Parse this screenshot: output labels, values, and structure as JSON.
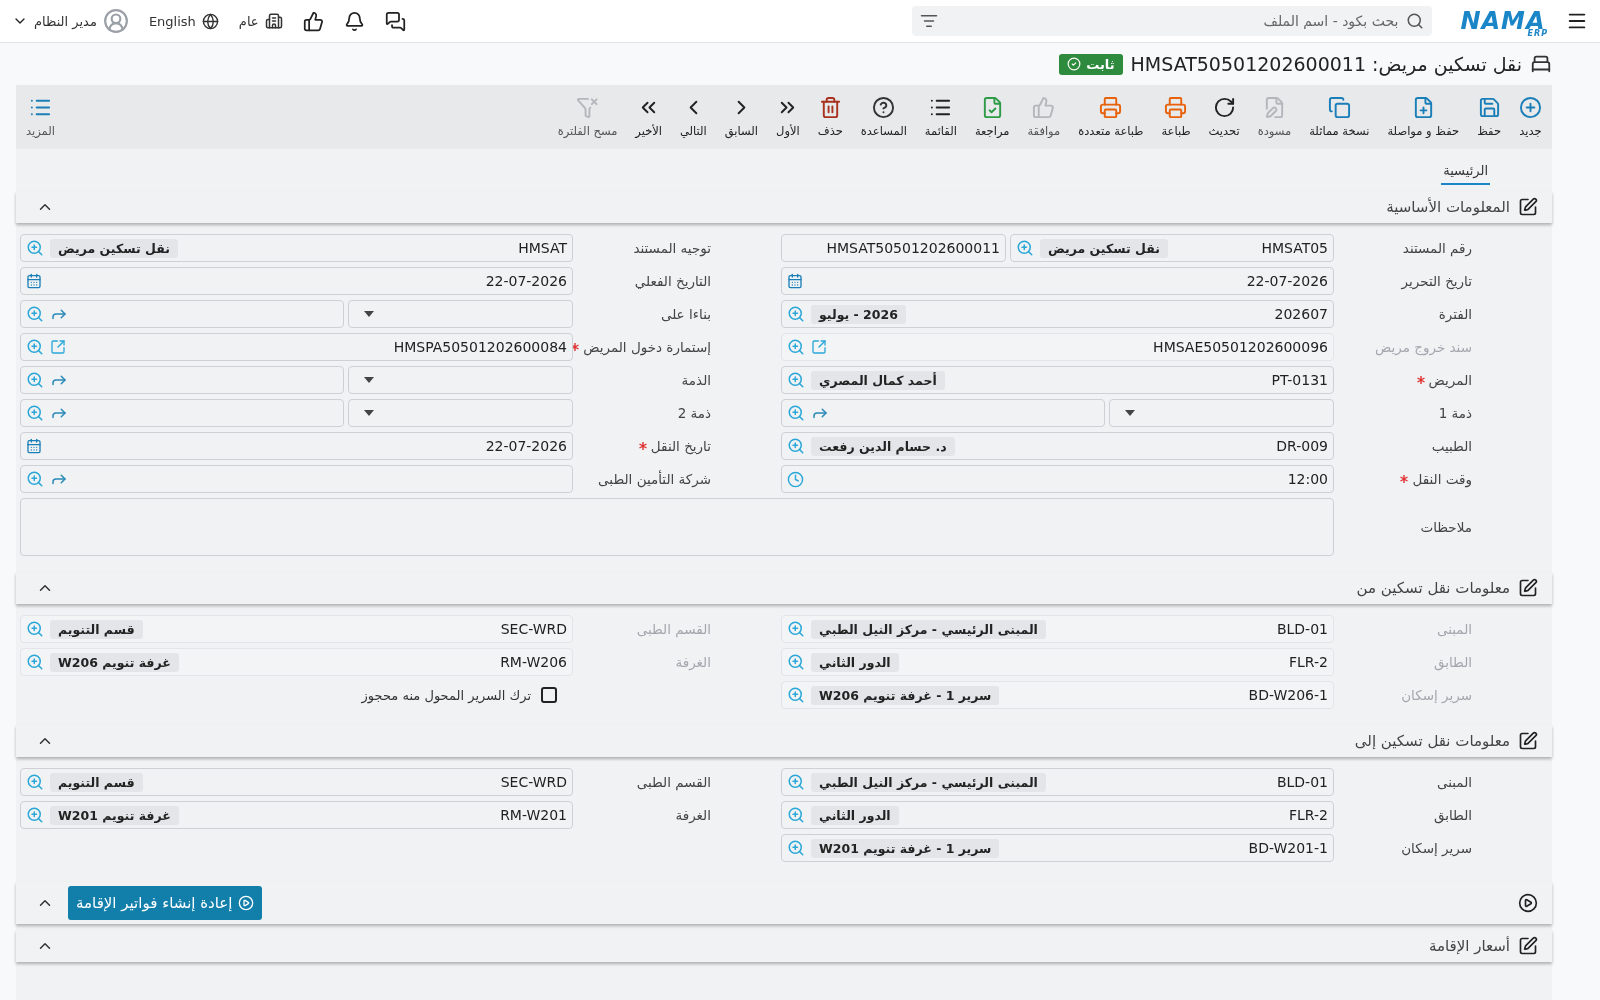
{
  "topbar": {
    "logo": {
      "name": "NAMA",
      "sub": "ERP"
    },
    "search": {
      "placeholder": "بحث بكود - اسم الملف"
    },
    "company": "عام",
    "language": "English",
    "user": "مدير النظام"
  },
  "title": {
    "text": "نقل تسكين مريض: HMSAT50501202600011",
    "status": "ثابت"
  },
  "toolbar": {
    "items": [
      {
        "kind": "new",
        "label": "جديد",
        "color": "#1a7fb8",
        "disabled": false
      },
      {
        "kind": "save",
        "label": "حفظ",
        "color": "#1a7fb8",
        "disabled": false
      },
      {
        "kind": "save-continue",
        "label": "حفظ و مواصلة",
        "color": "#1a7fb8",
        "disabled": false
      },
      {
        "kind": "duplicate",
        "label": "نسخة مماثلة",
        "color": "#1a7fb8",
        "disabled": false
      },
      {
        "kind": "draft",
        "label": "مسودة",
        "color": "#b3b7bc",
        "disabled": true
      },
      {
        "kind": "refresh",
        "label": "تحديث",
        "color": "#222222",
        "disabled": false
      },
      {
        "kind": "print",
        "label": "طباعة",
        "color": "#e8620c",
        "disabled": false
      },
      {
        "kind": "print-multi",
        "label": "طباعة متعددة",
        "color": "#e8620c",
        "disabled": false
      },
      {
        "kind": "approve",
        "label": "موافقة",
        "color": "#b3b7bc",
        "disabled": true
      },
      {
        "kind": "review",
        "label": "مراجعة",
        "color": "#2e9b47",
        "disabled": false
      },
      {
        "kind": "list",
        "label": "القائمة",
        "color": "#222222",
        "disabled": false
      },
      {
        "kind": "help",
        "label": "المساعدة",
        "color": "#333333",
        "disabled": false
      },
      {
        "kind": "delete",
        "label": "حذف",
        "color": "#a8321e",
        "disabled": false
      },
      {
        "kind": "first",
        "label": "الأول",
        "color": "#222222",
        "disabled": false
      },
      {
        "kind": "previous",
        "label": "السابق",
        "color": "#222222",
        "disabled": false
      },
      {
        "kind": "next",
        "label": "التالي",
        "color": "#222222",
        "disabled": false
      },
      {
        "kind": "last",
        "label": "الأخير",
        "color": "#222222",
        "disabled": false
      },
      {
        "kind": "clear-filter",
        "label": "مسح الفلترة",
        "color": "#b3b7bc",
        "disabled": true
      }
    ],
    "more": {
      "label": "المزيد"
    }
  },
  "tabs": [
    {
      "label": "الرئيسية",
      "selected": true
    }
  ],
  "sections": [
    {
      "kind": "form",
      "title": "المعلومات الأساسية",
      "expanded": true,
      "fields": [
        {
          "kind": "doc-number",
          "label": "رقم المستند",
          "required": false,
          "disabled": false,
          "value": "HMSAT05",
          "tag": "نقل تسكين مريض",
          "number": "HMSAT50501202600011"
        },
        {
          "kind": "lookup",
          "label": "توجيه المستند",
          "required": false,
          "disabled": false,
          "value": "HMSAT",
          "tag": "نقل تسكين مريض"
        },
        {
          "kind": "date",
          "label": "تاريخ التحرير",
          "required": false,
          "disabled": false,
          "value": "22-07-2026"
        },
        {
          "kind": "date",
          "label": "التاريخ الفعلي",
          "required": false,
          "disabled": false,
          "value": "22-07-2026"
        },
        {
          "kind": "lookup",
          "label": "الفترة",
          "required": false,
          "disabled": false,
          "value": "202607",
          "tag": "2026 - يوليو"
        },
        {
          "kind": "select-lookup",
          "label": "بناءا على",
          "required": false,
          "disabled": false
        },
        {
          "kind": "link",
          "label": "سند خروج مريض",
          "required": false,
          "disabled": true,
          "value": "HMSAE50501202600096"
        },
        {
          "kind": "link",
          "label": "إستمارة دخول المريض",
          "required": true,
          "disabled": false,
          "value": "HMSPA50501202600084"
        },
        {
          "kind": "lookup",
          "label": "المريض",
          "required": true,
          "disabled": false,
          "value": "PT-0131",
          "tag": "أحمد كمال المصري"
        },
        {
          "kind": "select-lookup",
          "label": "الذمة",
          "required": false,
          "disabled": false
        },
        {
          "kind": "select-lookup",
          "label": "ذمة 1",
          "required": false,
          "disabled": false
        },
        {
          "kind": "select-lookup",
          "label": "ذمة 2",
          "required": false,
          "disabled": false
        },
        {
          "kind": "lookup",
          "label": "الطبيب",
          "required": false,
          "disabled": false,
          "value": "DR-009",
          "tag": "د. حسام الدين رفعت"
        },
        {
          "kind": "date",
          "label": "تاريخ النقل",
          "required": true,
          "disabled": false,
          "value": "22-07-2026"
        },
        {
          "kind": "time",
          "label": "وقت النقل",
          "required": true,
          "disabled": false,
          "value": "12:00"
        },
        {
          "kind": "ref",
          "label": "شركة التأمين الطبى",
          "required": false,
          "disabled": false
        },
        {
          "kind": "textarea",
          "label": "ملاحظات",
          "required": false,
          "disabled": false
        }
      ]
    },
    {
      "kind": "form",
      "title": "معلومات نقل تسكين من",
      "expanded": true,
      "fields": [
        {
          "kind": "lookup",
          "label": "المبنى",
          "required": false,
          "disabled": true,
          "value": "BLD-01",
          "tag": "المبنى الرئيسي - مركز النيل الطبي"
        },
        {
          "kind": "lookup",
          "label": "القسم الطبى",
          "required": false,
          "disabled": true,
          "value": "SEC-WRD",
          "tag": "قسم التنويم"
        },
        {
          "kind": "lookup",
          "label": "الطابق",
          "required": false,
          "disabled": true,
          "value": "FLR-2",
          "tag": "الدور الثاني"
        },
        {
          "kind": "lookup",
          "label": "الغرفة",
          "required": false,
          "disabled": true,
          "value": "RM-W206",
          "tag": "غرفة تنويم W206"
        },
        {
          "kind": "lookup",
          "label": "سرير إسكان",
          "required": false,
          "disabled": true,
          "value": "BD-W206-1",
          "tag": "سرير 1 - غرفة تنويم W206"
        },
        {
          "kind": "checkbox",
          "text": "ترك السرير المحول منه محجوز",
          "checked": false
        }
      ]
    },
    {
      "kind": "form",
      "title": "معلومات نقل تسكين إلى",
      "expanded": true,
      "fields": [
        {
          "kind": "lookup",
          "label": "المبنى",
          "required": false,
          "disabled": false,
          "value": "BLD-01",
          "tag": "المبنى الرئيسي - مركز النيل الطبي"
        },
        {
          "kind": "lookup",
          "label": "القسم الطبى",
          "required": false,
          "disabled": false,
          "value": "SEC-WRD",
          "tag": "قسم التنويم"
        },
        {
          "kind": "lookup",
          "label": "الطابق",
          "required": false,
          "disabled": false,
          "value": "FLR-2",
          "tag": "الدور الثاني"
        },
        {
          "kind": "lookup",
          "label": "الغرفة",
          "required": false,
          "disabled": false,
          "value": "RM-W201",
          "tag": "غرفة تنويم W201"
        },
        {
          "kind": "lookup",
          "label": "سرير إسكان",
          "required": false,
          "disabled": false,
          "value": "BD-W201-1",
          "tag": "سرير 1 - غرفة تنويم W201"
        }
      ]
    },
    {
      "kind": "action",
      "expanded": true,
      "button": "إعادة إنشاء فواتير الإقامة"
    },
    {
      "kind": "form",
      "title": "أسعار الإقامة",
      "expanded": true
    }
  ]
}
